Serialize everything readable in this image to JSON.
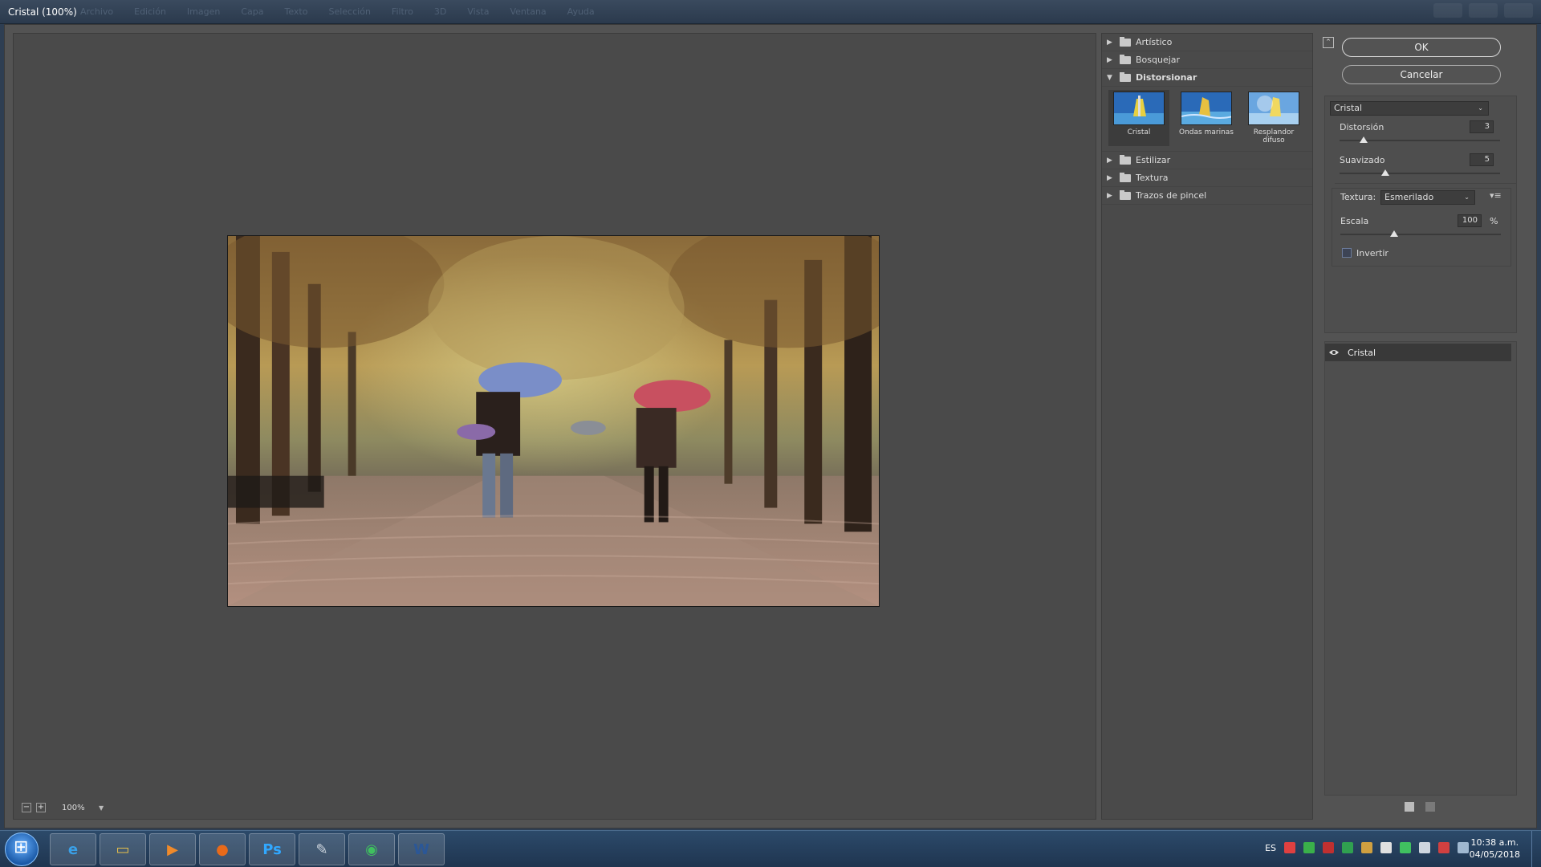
{
  "window": {
    "title": "Cristal (100%)",
    "ghost_menu": [
      "Archivo",
      "Edición",
      "Imagen",
      "Capa",
      "Texto",
      "Selección",
      "Filtro",
      "3D",
      "Vista",
      "Ventana",
      "Ayuda"
    ]
  },
  "preview": {
    "zoom": "100%",
    "zoom_out_symbol": "−",
    "zoom_in_symbol": "+"
  },
  "gallery": {
    "folders": [
      {
        "name": "Artístico",
        "open": false
      },
      {
        "name": "Bosquejar",
        "open": false
      },
      {
        "name": "Distorsionar",
        "open": true
      },
      {
        "name": "Estilizar",
        "open": false
      },
      {
        "name": "Textura",
        "open": false
      },
      {
        "name": "Trazos de pincel",
        "open": false
      }
    ],
    "distort_filters": [
      {
        "label": "Cristal",
        "selected": true
      },
      {
        "label": "Ondas marinas",
        "selected": false
      },
      {
        "label": "Resplandor difuso",
        "selected": false
      }
    ]
  },
  "buttons": {
    "ok": "OK",
    "cancel": "Cancelar"
  },
  "settings": {
    "filter_select": "Cristal",
    "distortion": {
      "label": "Distorsión",
      "value": "3",
      "min": 0,
      "max": 20
    },
    "smoothness": {
      "label": "Suavizado",
      "value": "5",
      "min": 1,
      "max": 15
    },
    "texture": {
      "label": "Textura:",
      "value": "Esmerilado"
    },
    "scale": {
      "label": "Escala",
      "value": "100",
      "unit": "%",
      "min": 50,
      "max": 200
    },
    "invert": {
      "label": "Invertir",
      "checked": false
    }
  },
  "layers": [
    {
      "name": "Cristal",
      "visible": true
    }
  ],
  "taskbar": {
    "apps": [
      {
        "name": "internet-explorer",
        "glyph": "e",
        "color": "#3aa0e8"
      },
      {
        "name": "file-explorer",
        "glyph": "▭",
        "color": "#e8c04a"
      },
      {
        "name": "media-player",
        "glyph": "▶",
        "color": "#f08a2a"
      },
      {
        "name": "firefox",
        "glyph": "●",
        "color": "#e86a1a"
      },
      {
        "name": "photoshop",
        "glyph": "Ps",
        "color": "#31a8ff"
      },
      {
        "name": "notepad",
        "glyph": "✎",
        "color": "#cfd6df"
      },
      {
        "name": "chrome",
        "glyph": "◉",
        "color": "#3fbf5f"
      },
      {
        "name": "word",
        "glyph": "W",
        "color": "#2b5797"
      }
    ],
    "language": "ES",
    "time": "10:38 a.m.",
    "date": "04/05/2018"
  }
}
